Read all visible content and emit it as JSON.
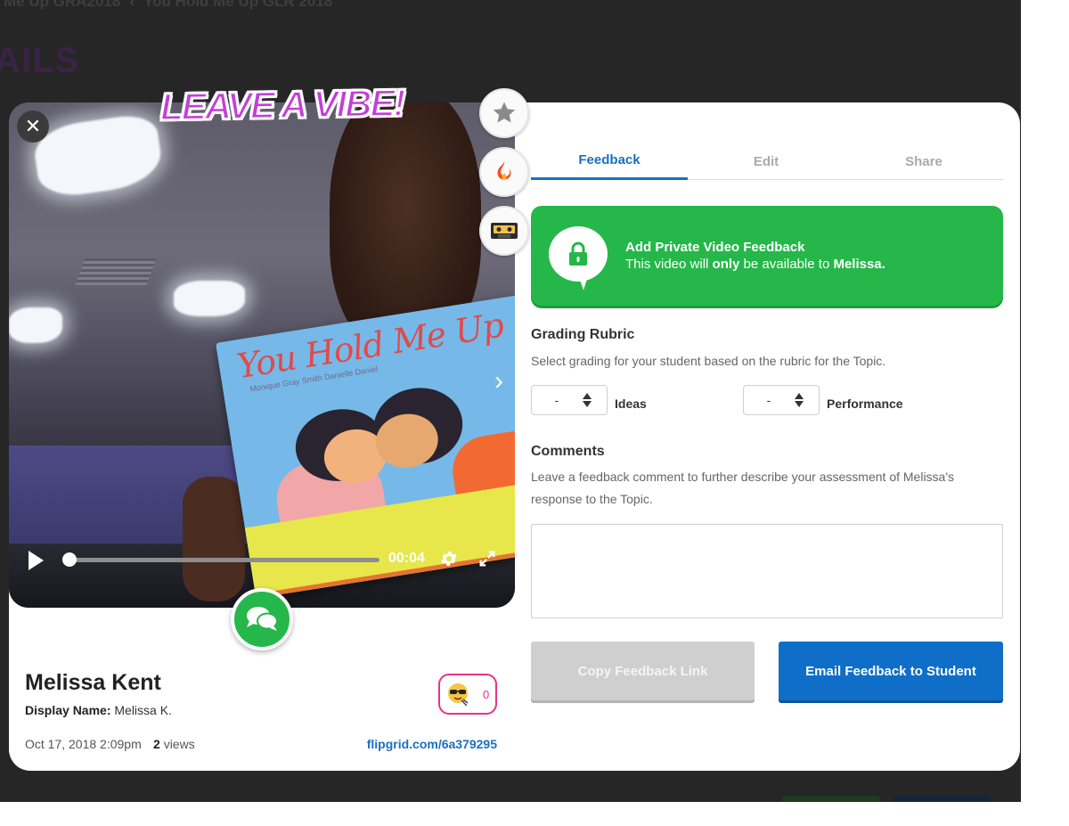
{
  "background_page": {
    "breadcrumb_left": "Me Up GRA2018",
    "breadcrumb_current": "You Hold Me Up GLR 2018",
    "heading": "AILS"
  },
  "video": {
    "overlay_title": "LEAVE A VIBE!",
    "book_title": "You Hold Me Up",
    "book_subtitle": "Monique Gray Smith   Danielle Daniel",
    "time": "00:04",
    "progress": 0.0
  },
  "reactions": [
    {
      "icon": "star-icon"
    },
    {
      "icon": "fire-icon"
    },
    {
      "icon": "cassette-icon"
    }
  ],
  "student": {
    "name": "Melissa Kent",
    "display_name_label": "Display Name:",
    "display_name": "Melissa K.",
    "date": "Oct 17, 2018 2:09pm",
    "views_count": "2",
    "views_label": "views",
    "link": "flipgrid.com/6a379295",
    "sticker_count": "0"
  },
  "tabs": [
    {
      "label": "Feedback",
      "active": true
    },
    {
      "label": "Edit",
      "active": false
    },
    {
      "label": "Share",
      "active": false
    }
  ],
  "private_feedback": {
    "title": "Add Private Video Feedback",
    "sub_prefix": "This video will ",
    "sub_bold": "only",
    "sub_middle": " be available to ",
    "sub_name": "Melissa."
  },
  "rubric": {
    "title": "Grading Rubric",
    "description": "Select grading for your student based on the rubric for the Topic.",
    "criteria": [
      {
        "value": "-",
        "label": "Ideas"
      },
      {
        "value": "-",
        "label": "Performance"
      }
    ]
  },
  "comments": {
    "title": "Comments",
    "description_line1": "Leave a feedback comment to further describe your assessment of Melissa's",
    "description_line2": "response to the Topic.",
    "value": ""
  },
  "buttons": {
    "copy_link": "Copy Feedback Link",
    "email": "Email Feedback to Student"
  },
  "colors": {
    "accent_blue": "#1b6fc3",
    "green": "#25b74a",
    "pink": "#e5338c",
    "vibe_purple": "#c33fd6"
  }
}
